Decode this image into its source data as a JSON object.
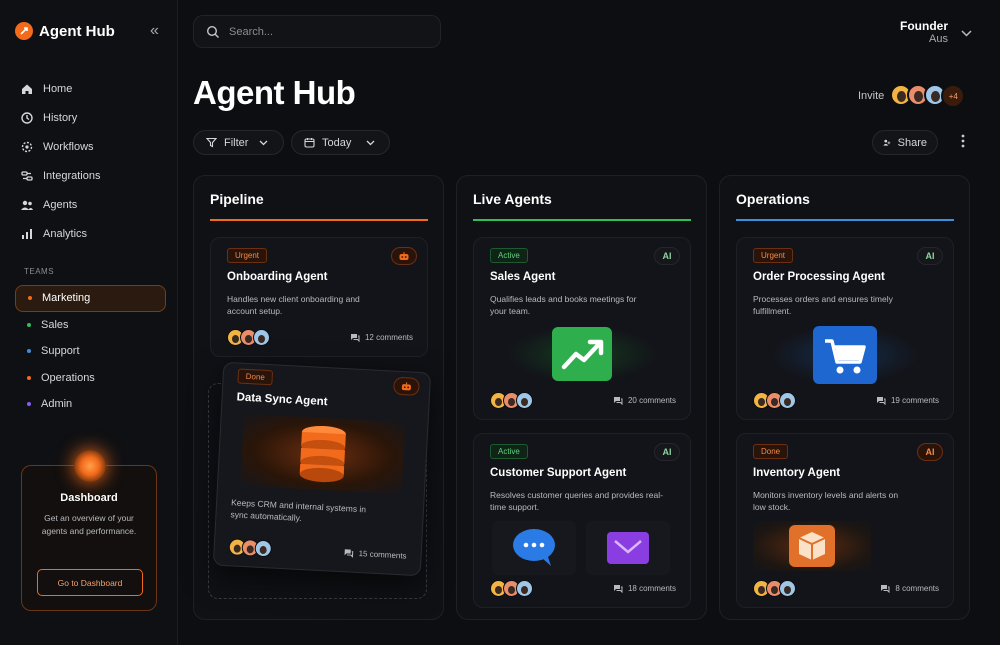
{
  "app": {
    "name": "Agent Hub",
    "collapse_glyph": "«"
  },
  "colors": {
    "accent": "#f26a1b",
    "pipeline": "#f26a1b",
    "live": "#2fbf5a",
    "ops": "#3b8fdc"
  },
  "nav": [
    {
      "label": "Home",
      "icon": "home-icon"
    },
    {
      "label": "History",
      "icon": "history-icon"
    },
    {
      "label": "Workflows",
      "icon": "workflows-icon"
    },
    {
      "label": "Integrations",
      "icon": "integrations-icon"
    },
    {
      "label": "Agents",
      "icon": "agents-icon"
    },
    {
      "label": "Analytics",
      "icon": "analytics-icon"
    }
  ],
  "teams": {
    "label": "TEAMS",
    "items": [
      {
        "label": "Marketing",
        "color": "#f26a1b"
      },
      {
        "label": "Sales",
        "color": "#2fbf5a"
      },
      {
        "label": "Support",
        "color": "#3b8fdc"
      },
      {
        "label": "Operations",
        "color": "#f26a1b"
      },
      {
        "label": "Admin",
        "color": "#8a5cf6"
      }
    ]
  },
  "promo": {
    "title": "Dashboard",
    "desc": "Get an overview of your agents and performance.",
    "button": "Go to Dashboard"
  },
  "search": {
    "placeholder": "Search..."
  },
  "user": {
    "name": "Founder",
    "sub": "Aus"
  },
  "header": {
    "title": "Agent Hub",
    "invite": "Invite",
    "invite_more": "+4",
    "filter": "Filter",
    "date": "Today",
    "share": "Share"
  },
  "columns": {
    "pipeline": {
      "title": "Pipeline",
      "cards": [
        {
          "tag": "Urgent",
          "title": "Onboarding Agent",
          "desc": "Handles new client onboarding and account setup.",
          "comments": "12 comments"
        },
        {
          "tag": "Done",
          "title": "Data Sync Agent",
          "desc": "Keeps CRM and internal systems in sync automatically.",
          "comments": "15 comments"
        }
      ]
    },
    "live": {
      "title": "Live Agents",
      "cards": [
        {
          "tag": "Active",
          "badge": "AI",
          "title": "Sales Agent",
          "desc": "Qualifies leads and books meetings for your team.",
          "comments": "20 comments"
        },
        {
          "tag": "Active",
          "badge": "AI",
          "title": "Customer Support Agent",
          "desc": "Resolves customer queries and provides real-time support.",
          "comments": "18 comments"
        }
      ]
    },
    "ops": {
      "title": "Operations",
      "cards": [
        {
          "tag": "Urgent",
          "badge": "AI",
          "title": "Order Processing Agent",
          "desc": "Processes orders and ensures timely fulfillment.",
          "comments": "19 comments"
        },
        {
          "tag": "Done",
          "badge": "AI",
          "title": "Inventory Agent",
          "desc": "Monitors inventory levels and alerts on low stock.",
          "comments": "8 comments"
        }
      ]
    }
  }
}
